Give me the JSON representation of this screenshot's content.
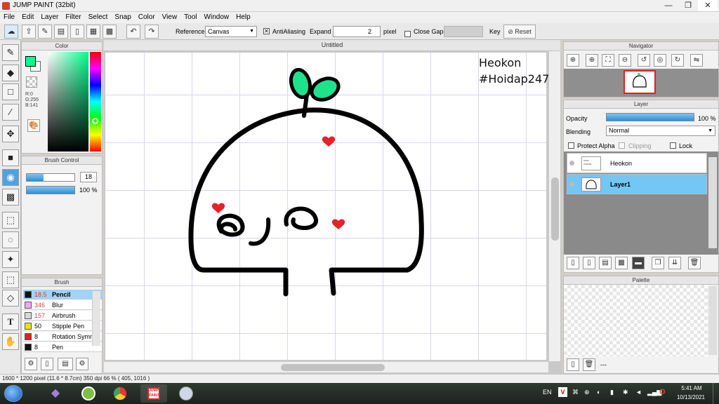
{
  "window": {
    "title": "JUMP PAINT (32bit)",
    "controls": [
      "—",
      "❐",
      "✕"
    ]
  },
  "menu": [
    "File",
    "Edit",
    "Layer",
    "Filter",
    "Select",
    "Snap",
    "Color",
    "View",
    "Tool",
    "Window",
    "Help"
  ],
  "toolbar": {
    "reference_label": "Reference",
    "reference_value": "Canvas",
    "antialiasing_label": "AntiAliasing",
    "antialiasing_checked": true,
    "expand_label": "Expand",
    "expand_value": "2",
    "pixel_label": "pixel",
    "close_gaps_label": "Close Gaps",
    "key_label": "Key",
    "reset_label": "Reset"
  },
  "color_panel": {
    "title": "Color",
    "r": "R:0",
    "g": "G:255",
    "b": "B:141",
    "foreground": "#00ff8d",
    "background": "#ffffff"
  },
  "brush_control": {
    "title": "Brush Control",
    "size_value": "18",
    "opacity_value": "100 %",
    "size_fraction": 0.36,
    "opacity_fraction": 1.0
  },
  "brush_panel": {
    "title": "Brush",
    "items": [
      {
        "size": "18.5",
        "name": "Pencil",
        "color": "#111111",
        "active": true
      },
      {
        "size": "346",
        "name": "Blur",
        "color": "#f0a8f0",
        "active": false
      },
      {
        "size": "157",
        "name": "Airbrush",
        "color": "#d8d8d8",
        "active": false
      },
      {
        "size": "50",
        "name": "Stipple Pen",
        "color": "#e8e020",
        "active": false
      },
      {
        "size": "8",
        "name": "Rotation Symm",
        "color": "#e02020",
        "active": false
      },
      {
        "size": "8",
        "name": "Pen",
        "color": "#111111",
        "active": false
      }
    ]
  },
  "canvas": {
    "tab_title": "Untitled",
    "text_line1": "Heokon",
    "text_line2": "#Hoidap247"
  },
  "navigator": {
    "title": "Navigator"
  },
  "layer_panel": {
    "title": "Layer",
    "opacity_label": "Opacity",
    "opacity_value": "100 %",
    "blending_label": "Blending",
    "blending_value": "Normal",
    "protect_alpha_label": "Protect Alpha",
    "clipping_label": "Clipping",
    "lock_label": "Lock",
    "layers": [
      {
        "name": "Heokon",
        "active": false
      },
      {
        "name": "Layer1",
        "active": true
      }
    ]
  },
  "palette": {
    "title": "Palette",
    "footer": "---"
  },
  "status": {
    "text": "1600 * 1200 pixel   (11.6 * 8.7cm)   350 dpi   66 %   ( 405, 1016 )"
  },
  "taskbar": {
    "lang": "EN",
    "time": "5:41 AM",
    "date": "10/13/2021"
  }
}
